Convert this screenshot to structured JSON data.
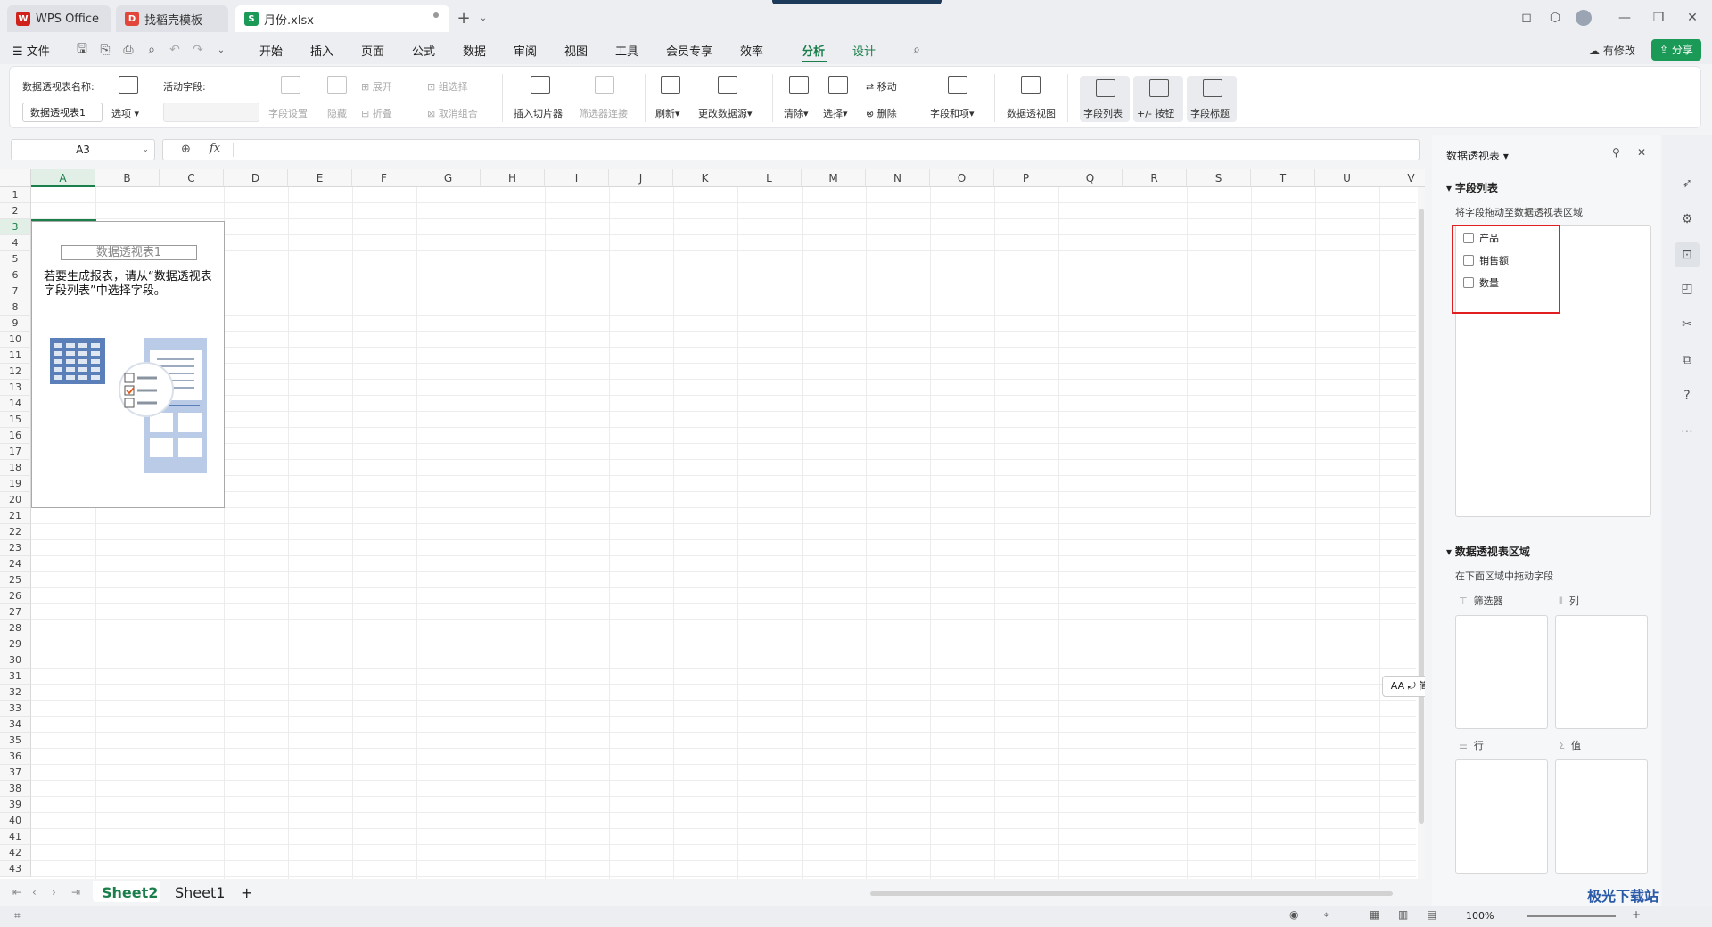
{
  "tabs": [
    {
      "label": "WPS Office",
      "icon": "wps-logo-icon"
    },
    {
      "label": "找稻壳模板",
      "icon": "docer-icon"
    },
    {
      "label": "月份.xlsx",
      "icon": "spreadsheet-icon"
    }
  ],
  "menubar": {
    "file": "文件",
    "items": [
      "开始",
      "插入",
      "页面",
      "公式",
      "数据",
      "审阅",
      "视图",
      "工具",
      "会员专享",
      "效率",
      "分析",
      "设计"
    ],
    "active": "分析",
    "has_changes": "有修改",
    "share": "分享"
  },
  "ribbon": {
    "pivot_name_label": "数据透视表名称:",
    "pivot_name_value": "数据透视表1",
    "options": "选项",
    "active_field_label": "活动字段:",
    "field_settings": "字段设置",
    "hide": "隐藏",
    "expand": "展开",
    "collapse": "折叠",
    "group_select": "组选择",
    "ungroup": "取消组合",
    "insert_slicer": "插入切片器",
    "filter_connection": "筛选器连接",
    "refresh": "刷新",
    "change_source": "更改数据源",
    "clear": "清除",
    "select": "选择",
    "move": "移动",
    "delete": "删除",
    "fields_items": "字段和项",
    "pivot_chart": "数据透视图",
    "field_list": "字段列表",
    "plus_minus": "+/- 按钮",
    "field_headers": "字段标题"
  },
  "formula": {
    "cell_ref": "A3",
    "fx": "fx"
  },
  "grid": {
    "columns": [
      "A",
      "B",
      "C",
      "D",
      "E",
      "F",
      "G",
      "H",
      "I",
      "J",
      "K",
      "L",
      "M",
      "N",
      "O",
      "P",
      "Q",
      "R",
      "S",
      "T",
      "U",
      "V"
    ],
    "rows": [
      "1",
      "2",
      "3",
      "4",
      "5",
      "6",
      "7",
      "8",
      "9",
      "10",
      "11",
      "12",
      "13",
      "14",
      "15",
      "16",
      "17",
      "18",
      "19",
      "20",
      "21",
      "22",
      "23",
      "24",
      "25",
      "26",
      "27",
      "28",
      "29",
      "30",
      "31",
      "32",
      "33",
      "34",
      "35",
      "36",
      "37",
      "38",
      "39",
      "40",
      "41",
      "42",
      "43"
    ],
    "selected_col": "A",
    "selected_row": "3"
  },
  "pivot_placeholder": {
    "name": "数据透视表1",
    "message": "若要生成报表，请从“数据透视表字段列表”中选择字段。"
  },
  "sheets": {
    "tabs": [
      "Sheet2",
      "Sheet1"
    ],
    "active": "Sheet2",
    "add": "+"
  },
  "float_button": "AA ⤾ 简",
  "panel": {
    "title": "数据透视表",
    "field_list_heading": "字段列表",
    "field_list_hint": "将字段拖动至数据透视表区域",
    "fields": [
      "产品",
      "销售额",
      "数量"
    ],
    "areas_heading": "数据透视表区域",
    "areas_hint": "在下面区域中拖动字段",
    "areas": {
      "filter": "筛选器",
      "column": "列",
      "row": "行",
      "value": "值"
    },
    "highlight_color": "#e02020"
  },
  "status": {
    "zoom": "100%"
  },
  "watermark": "极光下载站"
}
